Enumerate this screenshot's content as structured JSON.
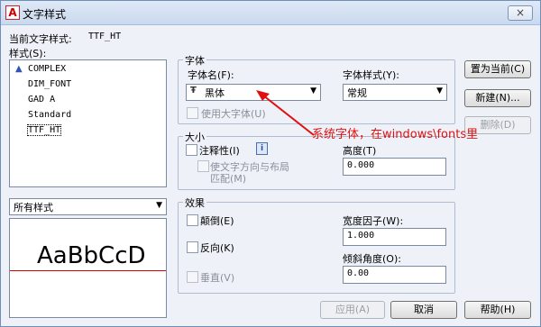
{
  "window": {
    "title": "文字样式",
    "close_label": "×",
    "app_icon": "A"
  },
  "current_style": {
    "label": "当前文字样式:",
    "value": "TTF_HT"
  },
  "styles_label": "样式(S):",
  "styles": [
    {
      "name": "COMPLEX",
      "icon": "annotative-icon"
    },
    {
      "name": "DIM_FONT"
    },
    {
      "name": "GAD A"
    },
    {
      "name": "Standard"
    },
    {
      "name": "TTF_HT",
      "selected": true
    }
  ],
  "filter": {
    "value": "所有样式"
  },
  "preview": {
    "text": "AaBbCcD"
  },
  "font": {
    "group_title": "字体",
    "name_label": "字体名(F):",
    "name_value": "黑体",
    "name_icon": "truetype-font-icon",
    "style_label": "字体样式(Y):",
    "style_value": "常规",
    "bigfont_label": "使用大字体(U)"
  },
  "size": {
    "group_title": "大小",
    "annotative_label": "注释性(I)",
    "info_label": "i",
    "match_label_line1": "使文字方向与布局",
    "match_label_line2": "匹配(M)",
    "height_label": "高度(T)",
    "height_value": "0.000"
  },
  "effects": {
    "group_title": "效果",
    "upside_label": "颠倒(E)",
    "backwards_label": "反向(K)",
    "vertical_label": "垂直(V)",
    "width_label": "宽度因子(W):",
    "width_value": "1.000",
    "oblique_label": "倾斜角度(O):",
    "oblique_value": "0.00"
  },
  "buttons": {
    "set_current": "置为当前(C)",
    "new": "新建(N)...",
    "delete": "删除(D)",
    "apply": "应用(A)",
    "cancel": "取消",
    "help": "帮助(H)"
  },
  "annotation": {
    "text": "系统字体，在windows\\fonts里",
    "color": "#e01010"
  }
}
